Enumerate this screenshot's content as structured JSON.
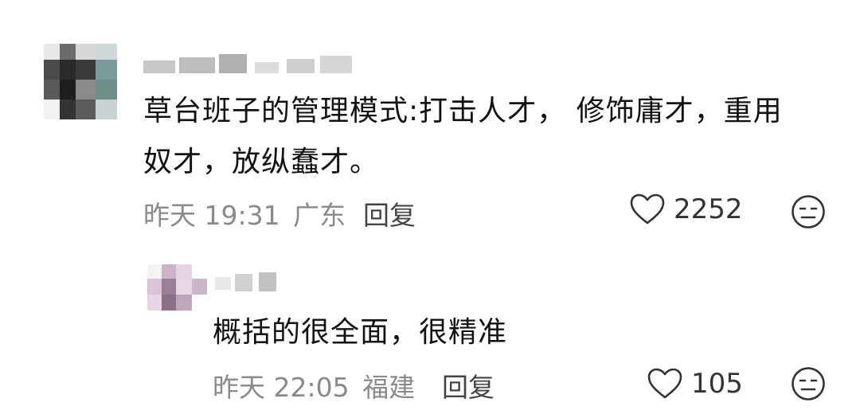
{
  "comments": [
    {
      "text_line1": "草台班子的管理模式:打击人才， 修饰庸才，重用",
      "text_line2": "奴才，放纵蠢才。",
      "date": "昨天 19:31",
      "location": "广东",
      "reply_label": "回复",
      "likes": "2252",
      "like_icon": "heart-outline-icon",
      "dislike_icon": "meh-face-icon"
    },
    {
      "text_line1": "概括的很全面，很精准",
      "date": "昨天 22:05",
      "location": "福建",
      "reply_label": "回复",
      "likes": "105",
      "like_icon": "heart-outline-icon",
      "dislike_icon": "meh-face-icon"
    }
  ]
}
